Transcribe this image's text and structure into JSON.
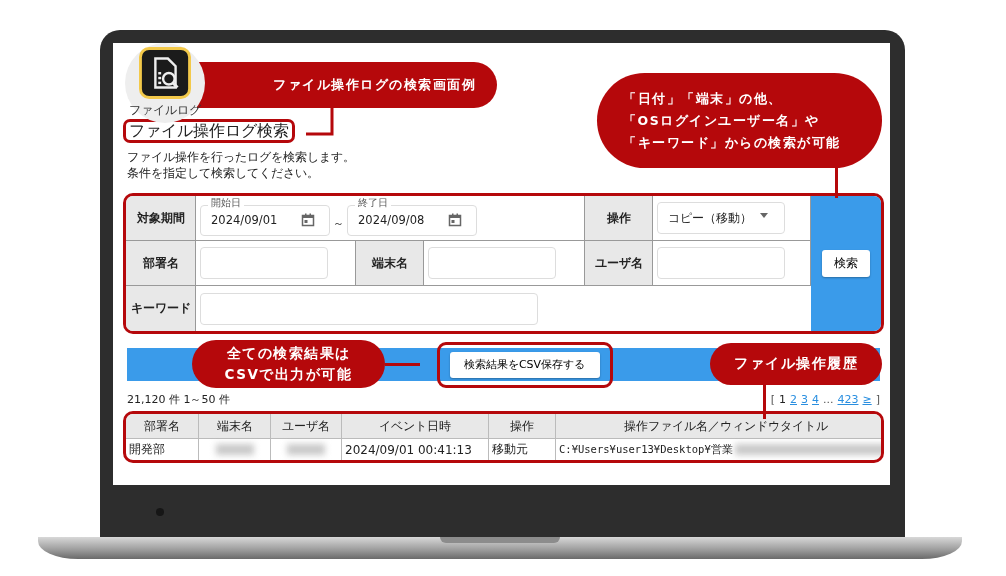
{
  "app_icon": {
    "label": "ファイルログ"
  },
  "page_title": "ファイル操作ログ検索",
  "description": [
    "ファイル操作を行ったログを検索します。",
    "条件を指定して検索してください。"
  ],
  "search_form": {
    "period_label": "対象期間",
    "start_date": {
      "label": "開始日",
      "value": "2024/09/01"
    },
    "separator": "～",
    "end_date": {
      "label": "終了日",
      "value": "2024/09/08"
    },
    "operation": {
      "label": "操作",
      "value": "コピー（移動）"
    },
    "department": {
      "label": "部署名"
    },
    "terminal": {
      "label": "端末名"
    },
    "user": {
      "label": "ユーザ名"
    },
    "keyword": {
      "label": "キーワード"
    },
    "search_button": "検索"
  },
  "csv_button": "検索結果をCSV保存する",
  "result_count": "21,120 件 1～50 件",
  "pagination": {
    "open": "[",
    "pages": [
      {
        "label": "1",
        "selected": true
      },
      {
        "label": "2",
        "selected": false
      },
      {
        "label": "3",
        "selected": false
      },
      {
        "label": "4",
        "selected": false
      }
    ],
    "ellipsis": "...",
    "last_page": "423",
    "next": "≥",
    "close": "]"
  },
  "results_table": {
    "columns": [
      "部署名",
      "端末名",
      "ユーザ名",
      "イベント日時",
      "操作",
      "操作ファイル名／ウィンドウタイトル"
    ],
    "rows": [
      {
        "cells": [
          {
            "text": "開発部",
            "redacted": false
          },
          {
            "redacted": true
          },
          {
            "redacted": true
          },
          {
            "text": "2024/09/01 00:41:13",
            "redacted": false
          },
          {
            "text": "移動元",
            "redacted": false
          },
          {
            "text": "C:¥Users¥user13¥Desktop¥営業",
            "redacted": true
          }
        ]
      }
    ]
  },
  "callouts": [
    {
      "lines": [
        "ファイル操作ログの検索画面例"
      ]
    },
    {
      "lines": [
        "「日付」「端末」の他、",
        "「OSログインユーザー名」や",
        "「キーワード」からの検索が可能"
      ]
    },
    {
      "lines": [
        "全ての検索結果は",
        "CSVで出力が可能"
      ]
    },
    {
      "lines": [
        "ファイル操作履歴"
      ]
    }
  ]
}
